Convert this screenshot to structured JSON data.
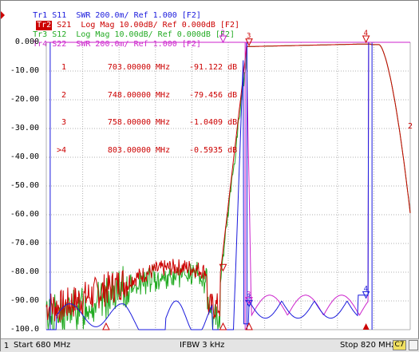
{
  "traces": [
    {
      "id": "Tr1",
      "label": "Tr1",
      "text": "S11  SWR 200.0m/ Ref 1.000 [F2]",
      "color": "#1a1adc",
      "active": false
    },
    {
      "id": "Tr2",
      "label": "Tr2",
      "text": "S21  Log Mag 10.00dB/ Ref 0.000dB [F2]",
      "color": "#cc0000",
      "active": true
    },
    {
      "id": "Tr3",
      "label": "Tr3",
      "text": "S12  Log Mag 10.00dB/ Ref 0.000dB [F2]",
      "color": "#22aa22",
      "active": false
    },
    {
      "id": "Tr4",
      "label": "Tr4",
      "text": "S22  SWR 200.0m/ Ref 1.000 [F2]",
      "color": "#cc22cc",
      "active": false
    }
  ],
  "y_ticks": [
    "0.000",
    "-10.00",
    "-20.00",
    "-30.00",
    "-40.00",
    "-50.00",
    "-60.00",
    "-70.00",
    "-80.00",
    "-90.00",
    "-100.0"
  ],
  "markers": [
    {
      "id": "1",
      "freq": "703.00000",
      "unit_f": "MHz",
      "value": "-91.122",
      "unit_v": "dB"
    },
    {
      "id": "2",
      "freq": "748.00000",
      "unit_f": "MHz",
      "value": "-79.456",
      "unit_v": "dB"
    },
    {
      "id": "3",
      "freq": "758.00000",
      "unit_f": "MHz",
      "value": "-1.0409",
      "unit_v": "dB"
    },
    {
      "id": ">4",
      "freq": "803.00000",
      "unit_f": "MHz",
      "value": "-0.5935",
      "unit_v": "dB"
    }
  ],
  "trace_end_label": "2",
  "plot_marker_labels": [
    "4",
    "2",
    "3",
    "4",
    "3",
    "3",
    "4"
  ],
  "status": {
    "channel": "1",
    "start": "Start 680 MHz",
    "ifbw": "IFBW 3 kHz",
    "stop": "Stop 820 MHz",
    "badge": "C7"
  },
  "colors": {
    "grid": "#b0b0b0",
    "tr1": "#1a1adc",
    "tr2": "#cc0000",
    "tr3": "#22aa22",
    "tr4": "#cc22cc"
  }
}
